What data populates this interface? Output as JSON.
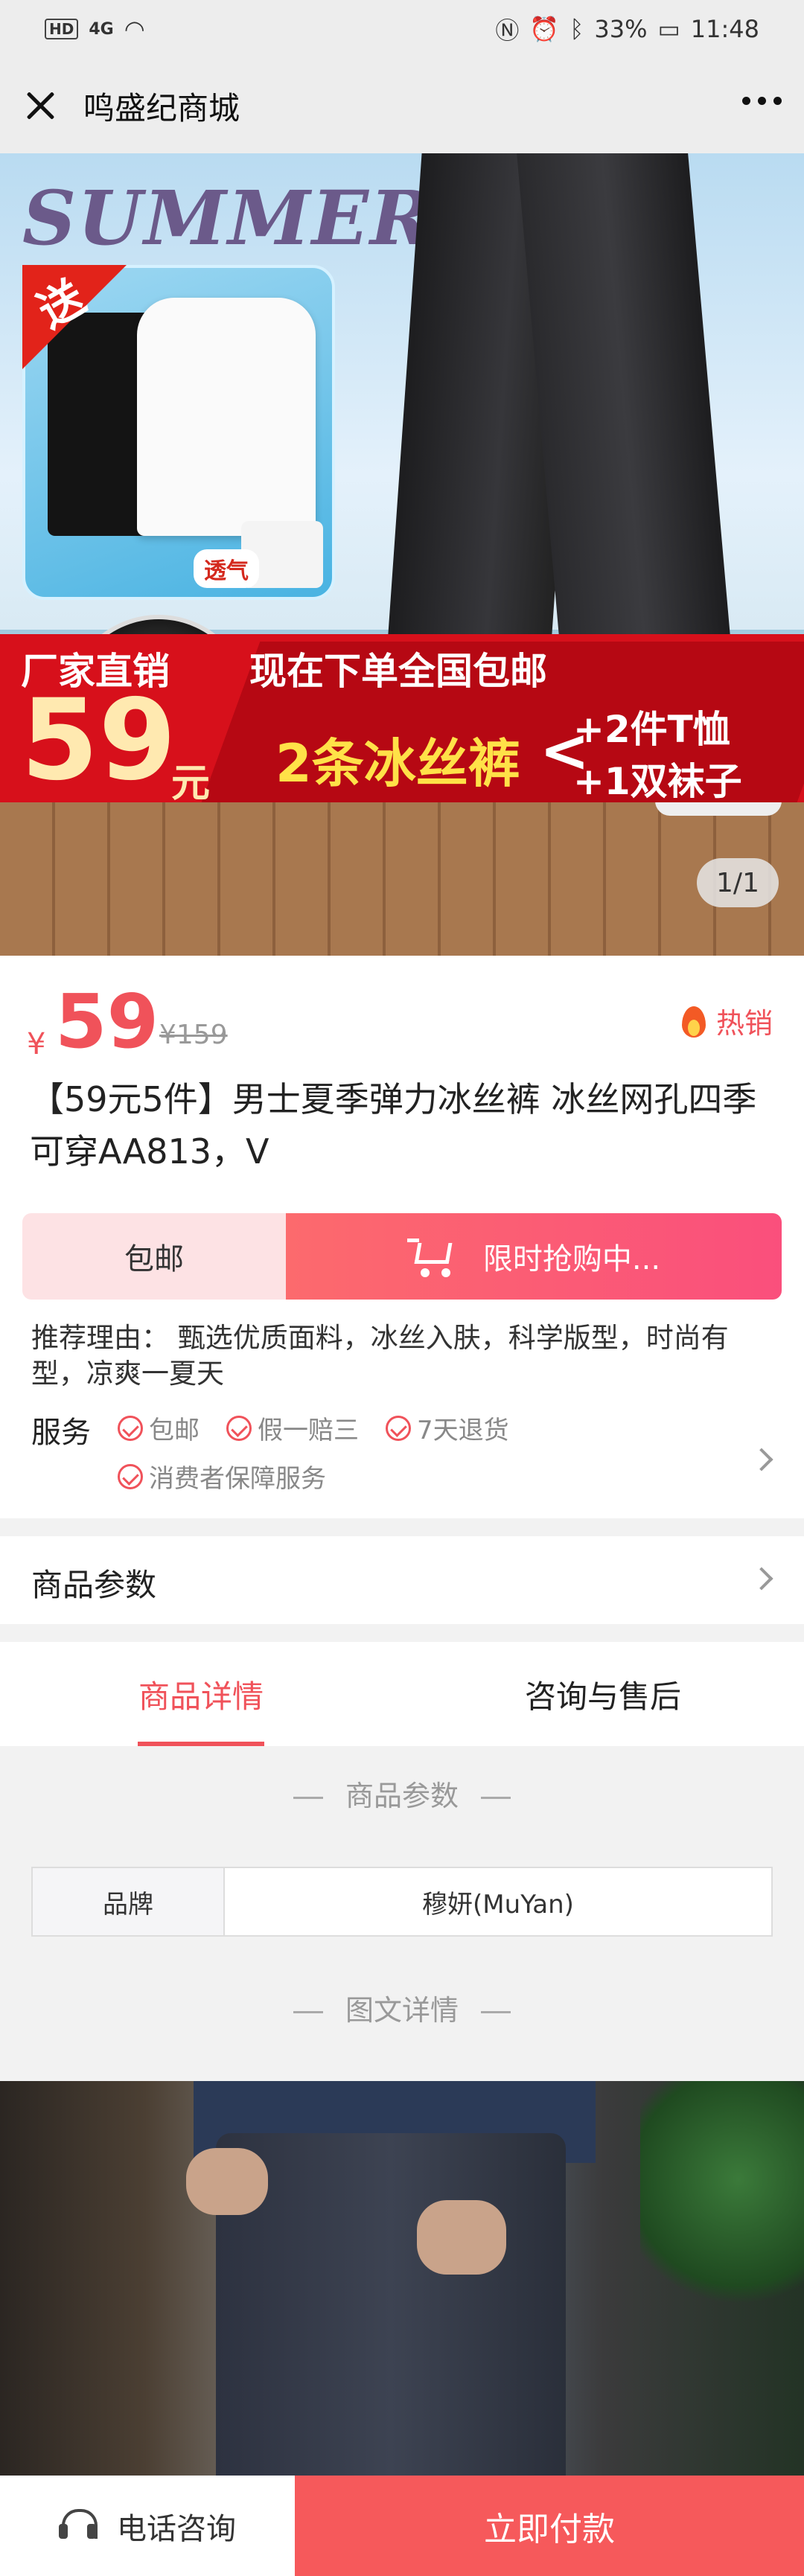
{
  "status_bar": {
    "left_hd": "HD",
    "left_signal": "4G",
    "battery": "33%",
    "time": "11:48"
  },
  "header": {
    "title": "鸣盛纪商城"
  },
  "banner": {
    "summer": "SUMMER",
    "gift": "送",
    "breathable": "透气",
    "factory_direct": "厂家直销",
    "order_now": "现在下单全国包邮",
    "price": "59",
    "price_unit": "元",
    "pants_count": "2条冰丝裤",
    "plus_tshirts": "+2件T恤",
    "plus_socks": "+1双袜子",
    "page_indicator": "1/1"
  },
  "product": {
    "currency": "¥",
    "price": "59",
    "original_price": "¥159",
    "hot_label": "热销",
    "title": "【59元5件】男士夏季弹力冰丝裤 冰丝网孔四季可穿AA813，V",
    "free_shipping_btn": "包邮",
    "flash_sale_btn": "限时抢购中...",
    "reason": "推荐理由：  甄选优质面料，冰丝入肤，科学版型，时尚有型，凉爽一夏天",
    "services_label": "服务",
    "services": [
      "包邮",
      "假一赔三",
      "7天退货",
      "消费者保障服务"
    ]
  },
  "params_row": {
    "label": "商品参数"
  },
  "tabs": [
    {
      "label": "商品详情",
      "active": true
    },
    {
      "label": "咨询与售后",
      "active": false
    }
  ],
  "sections": {
    "params_title": "商品参数",
    "detail_title": "图文详情"
  },
  "param_table": [
    {
      "key": "品牌",
      "value": "穆妍(MuYan)"
    }
  ],
  "bottom_bar": {
    "phone_label": "电话咨询",
    "pay_label": "立即付款"
  },
  "colors": {
    "accent": "#f0525a",
    "pay_button": "#f6595b",
    "banner_red": "#d7101b"
  }
}
